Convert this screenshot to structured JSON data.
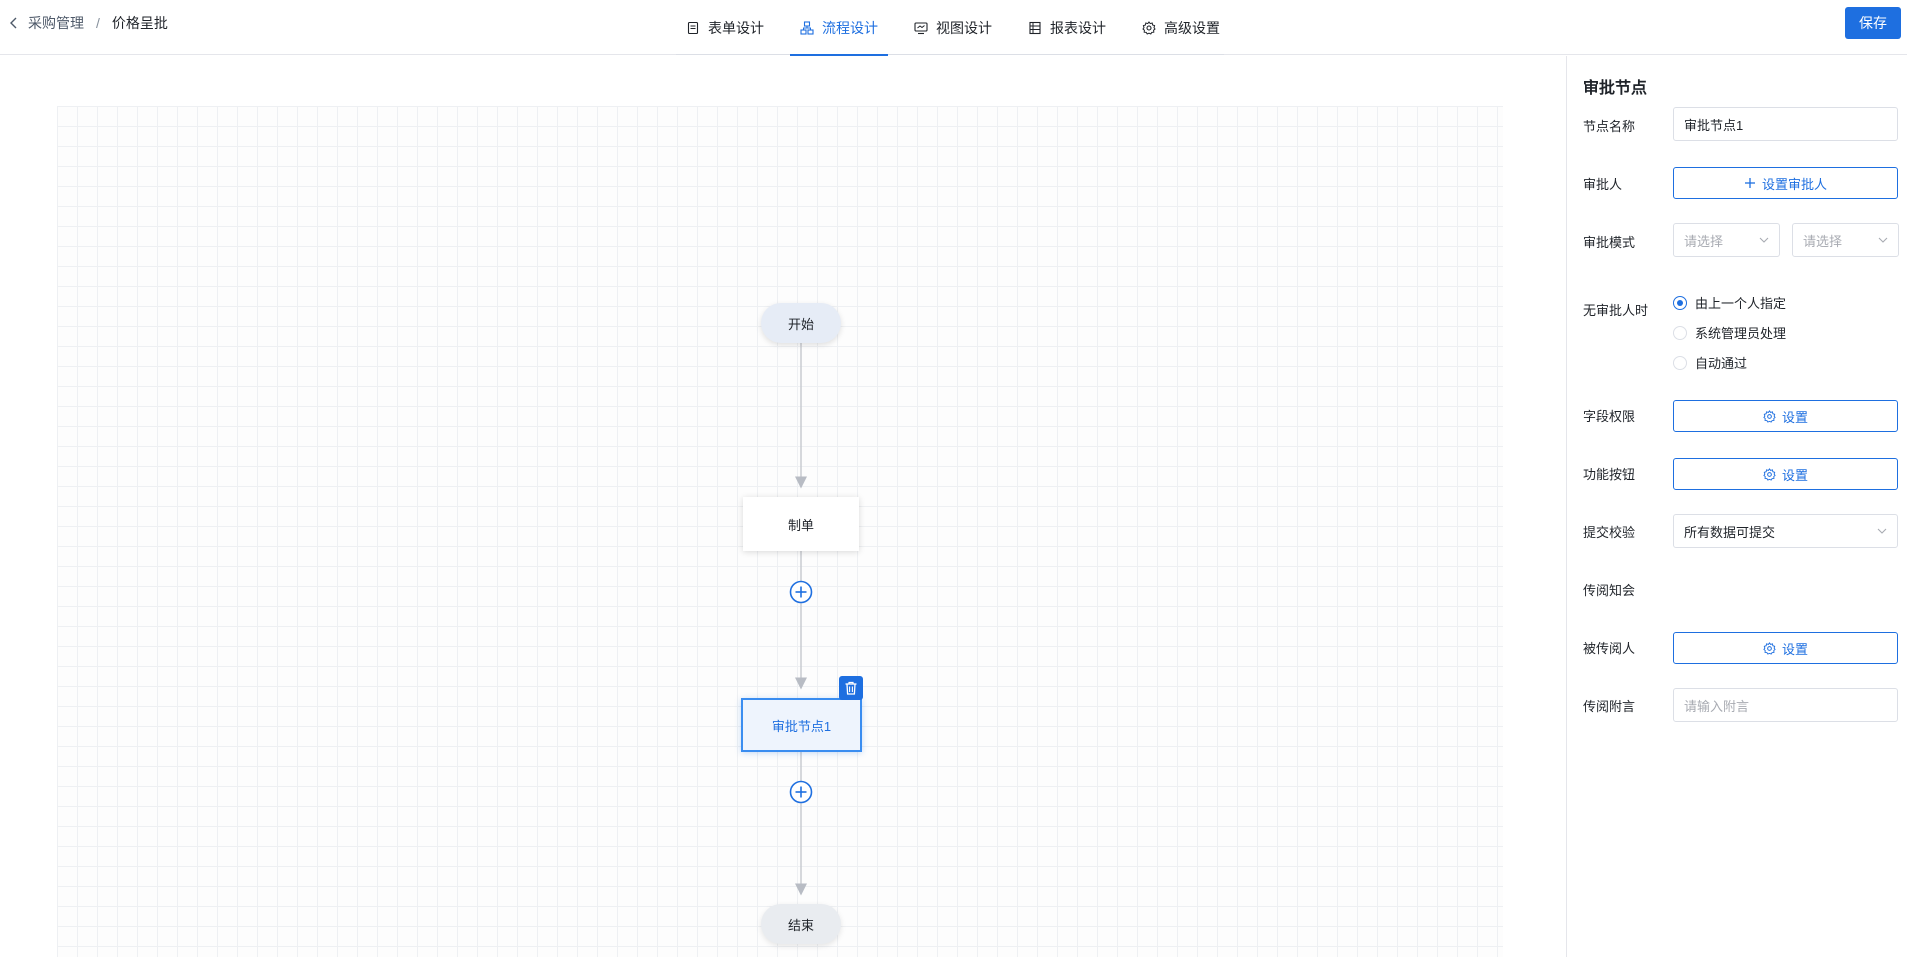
{
  "breadcrumb": {
    "parent": "采购管理",
    "separator": "/",
    "current": "价格呈批"
  },
  "tabs": [
    {
      "label": "表单设计",
      "icon": "form-icon"
    },
    {
      "label": "流程设计",
      "icon": "flow-icon",
      "active": true
    },
    {
      "label": "视图设计",
      "icon": "view-icon"
    },
    {
      "label": "报表设计",
      "icon": "report-icon"
    },
    {
      "label": "高级设置",
      "icon": "gear-icon"
    }
  ],
  "toolbar": {
    "save_label": "保存"
  },
  "flow": {
    "start": "开始",
    "nodes": [
      "制单",
      "审批节点1"
    ],
    "end": "结束"
  },
  "panel": {
    "title": "审批节点",
    "node_name_label": "节点名称",
    "node_name_value": "审批节点1",
    "approver_label": "审批人",
    "approver_button": "设置审批人",
    "mode_label": "审批模式",
    "mode_placeholder_1": "请选择",
    "mode_placeholder_2": "请选择",
    "no_approver_label": "无审批人时",
    "no_approver_options": [
      "由上一个人指定",
      "系统管理员处理",
      "自动通过"
    ],
    "no_approver_selected": 0,
    "field_perm_label": "字段权限",
    "field_perm_button": "设置",
    "func_button_label": "功能按钮",
    "func_button_button": "设置",
    "submit_check_label": "提交校验",
    "submit_check_value": "所有数据可提交",
    "cc_section_label": "传阅知会",
    "cc_person_label": "被传阅人",
    "cc_person_button": "设置",
    "cc_note_label": "传阅附言",
    "cc_note_placeholder": "请输入附言"
  },
  "colors": {
    "accent": "#1e6fe0",
    "selected_border": "#3a8df0"
  }
}
